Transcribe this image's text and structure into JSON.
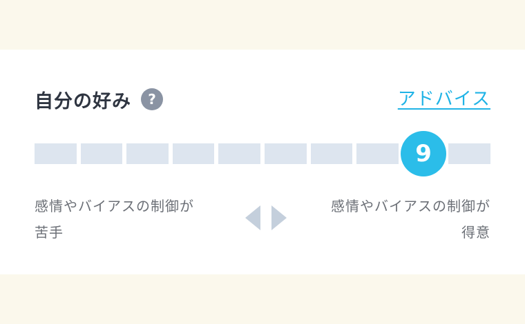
{
  "preference": {
    "title": "自分の好み",
    "help_icon": "?",
    "advice_link": "アドバイス",
    "scale": {
      "segments": 10,
      "selected": 9,
      "selected_label": "9"
    },
    "left_label": {
      "line1": "感情やバイアスの制御が",
      "line2": "苦手"
    },
    "right_label": {
      "line1": "感情やバイアスの制御が",
      "line2": "得意"
    }
  },
  "colors": {
    "background": "#fbf8ec",
    "card": "#ffffff",
    "segment": "#dde5ef",
    "accent": "#2bbde9",
    "link": "#1fb3e6",
    "arrow": "#c4cfdc"
  }
}
